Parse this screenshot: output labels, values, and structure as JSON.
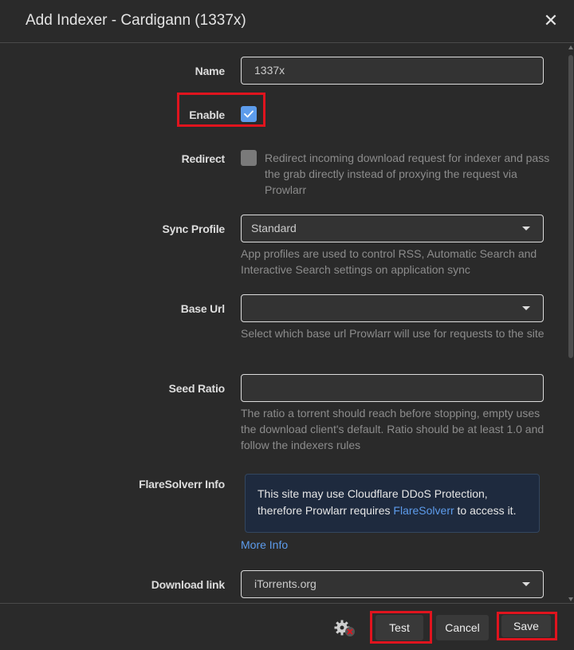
{
  "modal": {
    "title": "Add Indexer - Cardigann (1337x)",
    "close_glyph": "✕"
  },
  "fields": {
    "name": {
      "label": "Name",
      "value": "1337x"
    },
    "enable": {
      "label": "Enable",
      "checked": true
    },
    "redirect": {
      "label": "Redirect",
      "checked": false,
      "help": "Redirect incoming download request for indexer and pass the grab directly instead of proxying the request via Prowlarr"
    },
    "sync_profile": {
      "label": "Sync Profile",
      "value": "Standard",
      "help": "App profiles are used to control RSS, Automatic Search and Interactive Search settings on application sync"
    },
    "base_url": {
      "label": "Base Url",
      "value": "",
      "help": "Select which base url Prowlarr will use for requests to the site"
    },
    "seed_ratio": {
      "label": "Seed Ratio",
      "value": "",
      "help": "The ratio a torrent should reach before stopping, empty uses the download client's default. Ratio should be at least 1.0 and follow the indexers rules"
    },
    "flaresolverr": {
      "label": "FlareSolverr Info",
      "alert_before": "This site may use Cloudflare DDoS Protection, therefore Prowlarr requires ",
      "alert_link": "FlareSolverr",
      "alert_after": " to access it.",
      "more_info": "More Info"
    },
    "download_link": {
      "label": "Download link",
      "value": "iTorrents.org"
    }
  },
  "footer": {
    "settings_icon": "gear-icon",
    "test_label": "Test",
    "cancel_label": "Cancel",
    "save_label": "Save"
  },
  "colors": {
    "accent": "#5d9cec",
    "highlight_box": "#e0141e",
    "background": "#2a2a2a"
  }
}
